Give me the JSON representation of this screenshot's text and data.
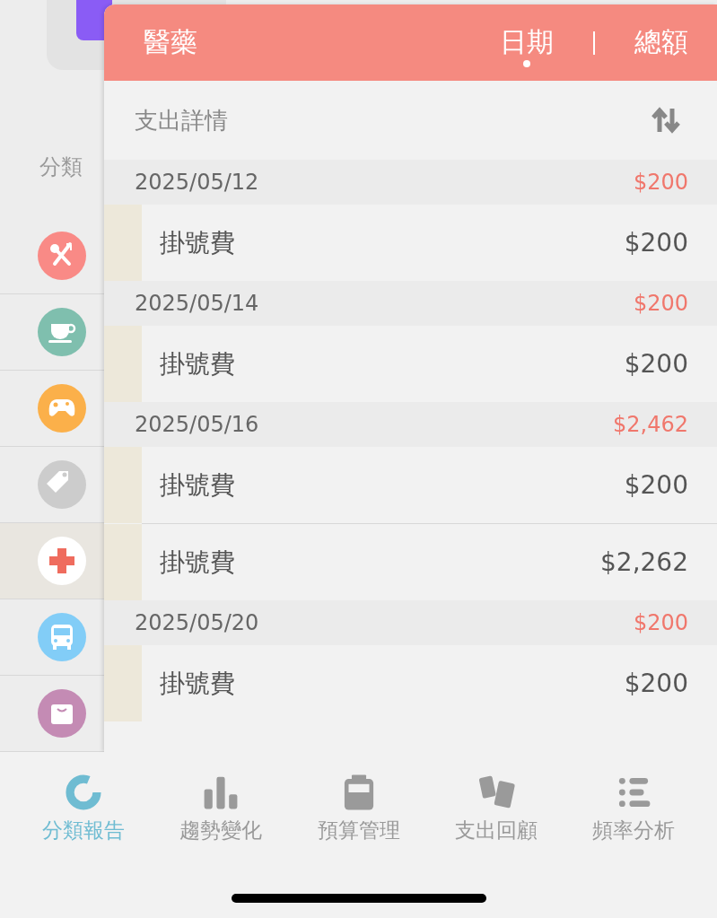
{
  "background": {
    "section_label": "分類",
    "categories": [
      {
        "kind": "utensils",
        "color": "#f98a86",
        "selected": false
      },
      {
        "kind": "cup",
        "color": "#7fbfae",
        "selected": false
      },
      {
        "kind": "gamepad",
        "color": "#fbb04a",
        "selected": false
      },
      {
        "kind": "tag",
        "color": "#cccccc",
        "selected": false
      },
      {
        "kind": "cross",
        "color": "#ffffff",
        "selected": true
      },
      {
        "kind": "bus",
        "color": "#82cdf7",
        "selected": false
      },
      {
        "kind": "bag",
        "color": "#c48bb4",
        "selected": false
      }
    ]
  },
  "panel": {
    "title": "醫藥",
    "sort_tabs": [
      {
        "label": "日期",
        "selected": true
      },
      {
        "label": "總額",
        "selected": false
      }
    ],
    "section_title": "支出詳情",
    "groups": [
      {
        "date": "2025/05/12",
        "total": "$200",
        "items": [
          {
            "name": "掛號費",
            "amount": "$200"
          }
        ]
      },
      {
        "date": "2025/05/14",
        "total": "$200",
        "items": [
          {
            "name": "掛號費",
            "amount": "$200"
          }
        ]
      },
      {
        "date": "2025/05/16",
        "total": "$2,462",
        "items": [
          {
            "name": "掛號費",
            "amount": "$200"
          },
          {
            "name": "掛號費",
            "amount": "$2,262"
          }
        ]
      },
      {
        "date": "2025/05/20",
        "total": "$200",
        "items": [
          {
            "name": "掛號費",
            "amount": "$200"
          }
        ]
      }
    ]
  },
  "tab_bar": [
    {
      "kind": "donut",
      "label": "分類報告",
      "selected": true
    },
    {
      "kind": "bars",
      "label": "趨勢變化",
      "selected": false
    },
    {
      "kind": "budget",
      "label": "預算管理",
      "selected": false
    },
    {
      "kind": "cards",
      "label": "支出回顧",
      "selected": false
    },
    {
      "kind": "list",
      "label": "頻率分析",
      "selected": false
    }
  ]
}
